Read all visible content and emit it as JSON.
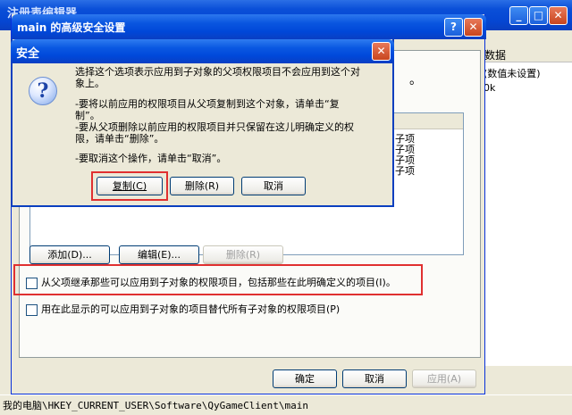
{
  "background_window": {
    "title": "注册表编辑器",
    "col_header": "数据",
    "right_items": [
      "(数值未设置)",
      "0k"
    ],
    "tree_items": [
      "子项",
      "子项",
      "子项",
      "子项"
    ],
    "status": "我的电脑\\HKEY_CURRENT_USER\\Software\\QyGameClient\\main"
  },
  "advanced_dialog": {
    "title": "main 的高级安全设置",
    "help_button": "?",
    "close_button": "✕",
    "partial_text": "。",
    "buttons": {
      "add": "添加(D)...",
      "edit": "编辑(E)...",
      "remove": "删除(R)"
    },
    "inherit_checkbox": "从父项继承那些可以应用到子对象的权限项目，包括那些在此明确定义的项目(I)。",
    "replace_checkbox": "用在此显示的可以应用到子对象的项目替代所有子对象的权限项目(P)",
    "ok": "确定",
    "cancel": "取消",
    "apply": "应用(A)"
  },
  "message_box": {
    "title": "安全",
    "icon": "question-icon",
    "lines": [
      "选择这个选项表示应用到子对象的父项权限项目不会应用到这个对",
      "象上。",
      "",
      "-要将以前应用的权限项目从父项复制到这个对象，请单击“复",
      "制”。",
      "-要从父项删除以前应用的权限项目并只保留在这儿明确定义的权",
      "限，请单击“删除”。",
      "",
      "-要取消这个操作，请单击“取消”。"
    ],
    "copy": "复制(C)",
    "remove": "删除(R)",
    "cancel": "取消"
  },
  "window_controls": {
    "minimize": "_",
    "maximize": "□",
    "close": "✕"
  },
  "colors": {
    "highlight_box": "#e03030",
    "title_bar": "#0a56e0"
  }
}
